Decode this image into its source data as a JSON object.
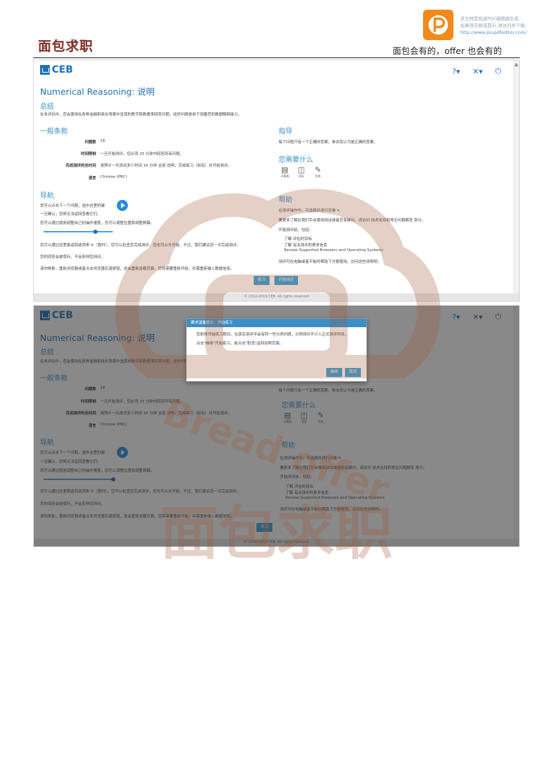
{
  "header": {
    "brand": "面包求职",
    "slogan": "面包会有的，offer 也会有的",
    "pdf_note": [
      "该文档是极速PDF编辑器生成,",
      "如果想去掉该提示,请访问并下载:",
      "http://www.jisupdfeditor.com/"
    ]
  },
  "app": {
    "logo_text": "CEB",
    "page_title": "Numerical Reasoning: 说明",
    "top_icons": [
      "help-icon",
      "audio-off-icon",
      "exit-icon"
    ]
  },
  "summary": {
    "heading": "总结",
    "text": "在本评估中，您会使用在各种金融和商业场景中呈现的数字和数据来回答问题，这些问题是用于测量您的数据解释能力。"
  },
  "general": {
    "heading": "一般条款",
    "rows": [
      {
        "label": "问题数",
        "value": "18"
      },
      {
        "label": "时间限制",
        "value": "一旦开始测评，您必须 25 分钟内回答所有问题。"
      },
      {
        "label": "完成测评的总时间",
        "value": "请预计一共测试多少时间 30 分钟 且容 说明，完成练习（如有）并开始测评。"
      },
      {
        "label": "语言",
        "value": "Chinese (PRC)"
      }
    ]
  },
  "navigation": {
    "heading": "导航",
    "lines": [
      "您可以点击下一个问题，选中这里的键",
      "一旦确认，您将无法返回查看它们。",
      "您可以通过使用调整自己的操作速度，您可以调整位置和调整屏幕。",
      "您可以通过这里面返回选项来 ⟳（暂时），您可以检查您完成测评，您也可从头开始，不过，我们建议您一次完成测评。",
      "您的回答会被保存，不会影响您测评。",
      "请勿刷新，重新浏览器或者点击浏览器后退按钮，这会重新加载页面，您将需要重新开始，并需重新输入数据信息。"
    ]
  },
  "guidance": {
    "heading": "指导",
    "text": "每个问题只有一个正确的答案，单击您认为是正确的答案。"
  },
  "materials": {
    "heading": "您需要什么",
    "items": [
      {
        "icon": "calculator-icon",
        "label": "计算器"
      },
      {
        "icon": "mouse-icon",
        "label": "鼠标"
      },
      {
        "icon": "pen-icon",
        "label": "纸笔"
      }
    ]
  },
  "help": {
    "heading": "帮助",
    "lines": [
      "在测评操作中，可选择并进行对准 ✎",
      "要更多了解在我们平台使用测试或者您有疑问，请访问 技术支持和常见问题解答 部分。",
      "开始测评前，包括："
    ],
    "bullets": [
      "了解 评估的目标",
      "了解 有关测评的更多信息",
      "Review Supported Browsers and Operating Systems"
    ],
    "footer_line": "测评可在电脑或者平板的帮助下方便使用，访问这些说明吧。"
  },
  "buttons": {
    "practice": "练习",
    "start": "开始测评"
  },
  "footer": "© 2014-2019 CEB. All rights reserved",
  "dialog": {
    "title": "要求温馨提示：开始练习",
    "lines": [
      "您即将开始练习题目，在真实测评中会有同一些示例问题，示例测评不计入正式测评时间。",
      "点击\"继续\"开始练习，或点击\"取消\"返回说明页面。"
    ],
    "ok": "继续",
    "cancel": "取消"
  },
  "watermark": {
    "text": "Bread offer",
    "brand": "面包求职"
  }
}
